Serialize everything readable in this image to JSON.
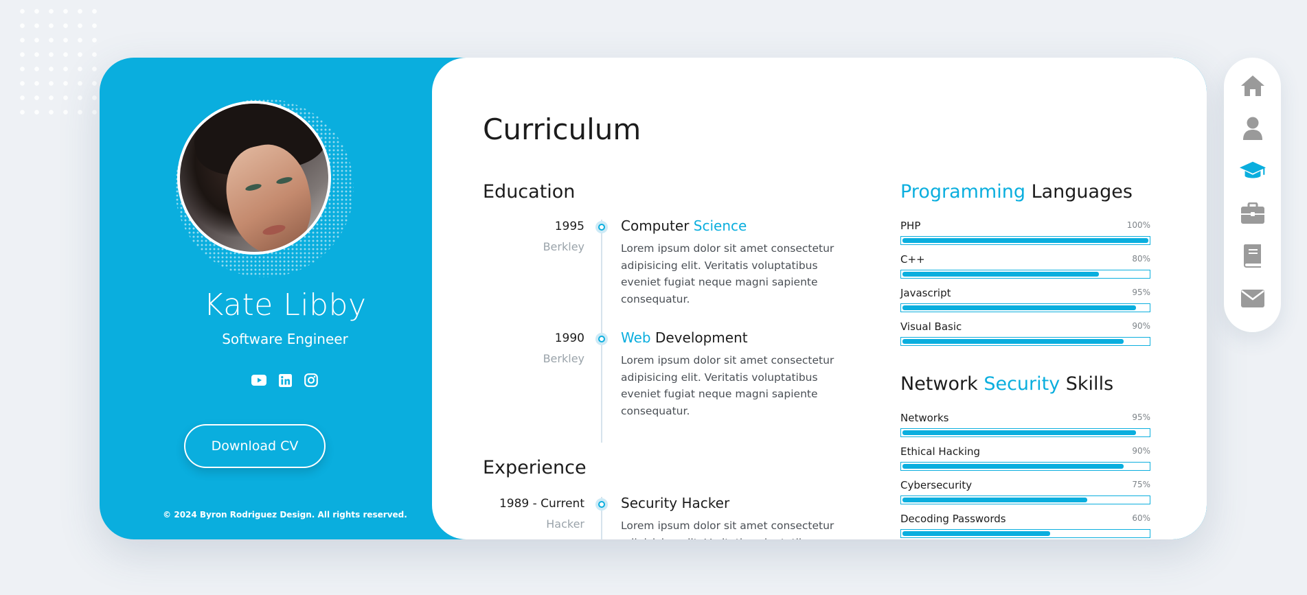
{
  "profile": {
    "name": "Kate Libby",
    "role": "Software Engineer",
    "download_label": "Download CV",
    "copyright": "© 2024 Byron Rodriguez Design. All rights reserved.",
    "socials": [
      "youtube-icon",
      "linkedin-icon",
      "instagram-icon"
    ]
  },
  "curriculum": {
    "title": "Curriculum",
    "education": {
      "title": "Education",
      "items": [
        {
          "year": "1995",
          "place": "Berkley",
          "title_plain": "Computer ",
          "title_highlight": "Science",
          "description": "Lorem ipsum dolor sit amet consectetur adipisicing elit. Veritatis voluptatibus eveniet fugiat neque magni sapiente consequatur."
        },
        {
          "year": "1990",
          "place": "Berkley",
          "title_highlight": "Web",
          "title_plain": " Development",
          "description": "Lorem ipsum dolor sit amet consectetur adipisicing elit. Veritatis voluptatibus eveniet fugiat neque magni sapiente consequatur."
        }
      ]
    },
    "experience": {
      "title": "Experience",
      "items": [
        {
          "year": "1989 - Current",
          "place": "Hacker",
          "title": "Security Hacker",
          "description": "Lorem ipsum dolor sit amet consectetur adipisicing elit. Veritatis voluptatibus eveniet fugiat neque magni sapiente consequatur."
        }
      ]
    },
    "programming": {
      "title_highlight": "Programming",
      "title_plain": " Languages",
      "skills": [
        {
          "name": "PHP",
          "percent": "100%",
          "value": 100
        },
        {
          "name": "C++",
          "percent": "80%",
          "value": 80
        },
        {
          "name": "Javascript",
          "percent": "95%",
          "value": 95
        },
        {
          "name": "Visual Basic",
          "percent": "90%",
          "value": 90
        }
      ]
    },
    "security": {
      "title_pre": "Network ",
      "title_highlight": "Security",
      "title_post": " Skills",
      "skills": [
        {
          "name": "Networks",
          "percent": "95%",
          "value": 95
        },
        {
          "name": "Ethical Hacking",
          "percent": "90%",
          "value": 90
        },
        {
          "name": "Cybersecurity",
          "percent": "75%",
          "value": 75
        },
        {
          "name": "Decoding Passwords",
          "percent": "60%",
          "value": 60
        }
      ]
    }
  },
  "sidenav": {
    "items": [
      "home-icon",
      "user-icon",
      "graduation-cap-icon",
      "briefcase-icon",
      "book-icon",
      "envelope-icon"
    ],
    "active": "graduation-cap-icon"
  },
  "colors": {
    "accent": "#0aaede",
    "nav_inactive": "#9a9a9a"
  }
}
